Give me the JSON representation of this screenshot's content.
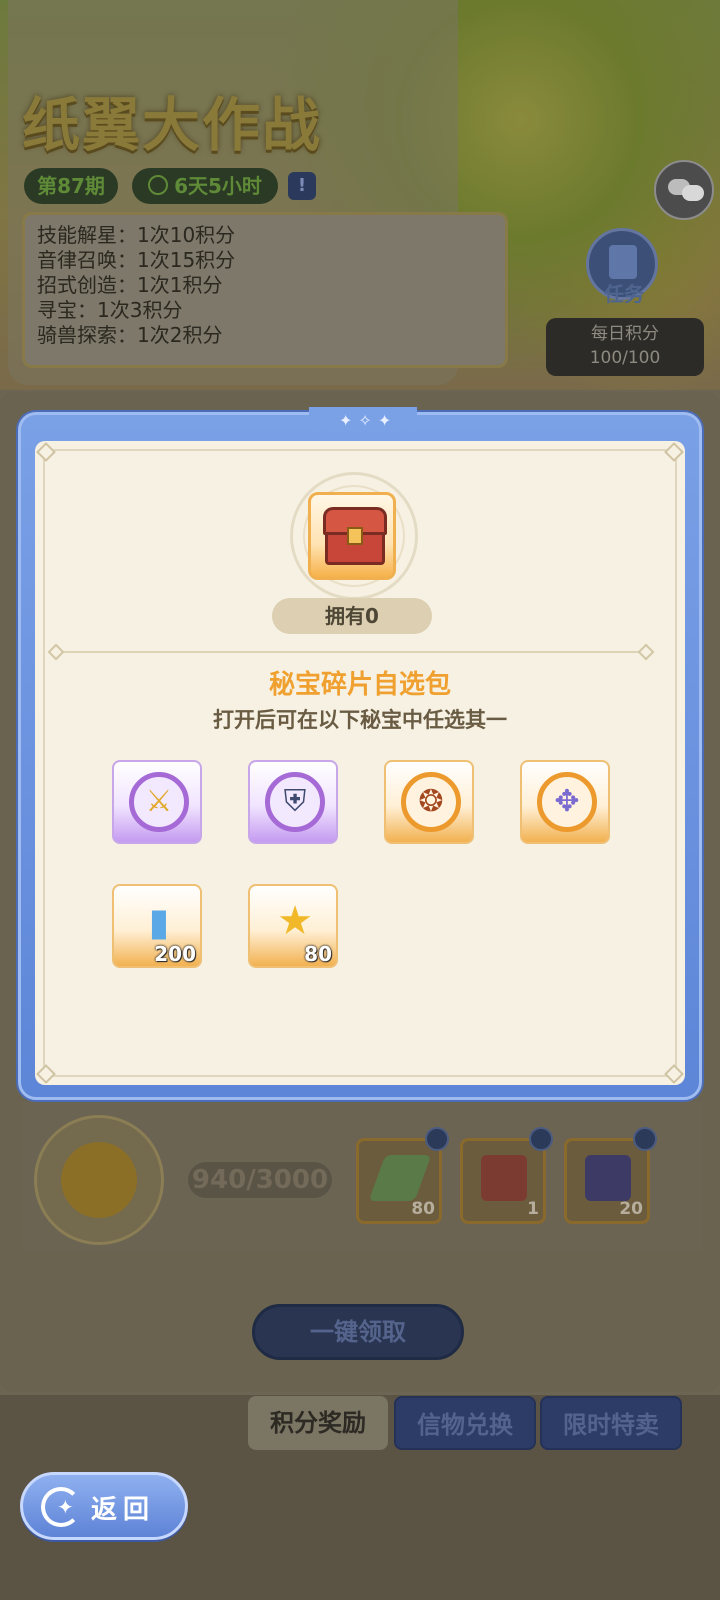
{
  "header": {
    "title": "纸翼大作战",
    "issue": "第87期",
    "countdown": "6天5小时",
    "info_icon": "!"
  },
  "rules": [
    "技能解星：1次10积分",
    "音律召唤：1次15积分",
    "招式创造：1次1积分",
    "寻宝：1次3积分",
    "骑兽探索：1次2积分"
  ],
  "side": {
    "task_label": "任务",
    "daily_label": "每日积分",
    "daily_value": "100/100"
  },
  "progress": {
    "text": "940/3000",
    "current": 940,
    "max": 3000
  },
  "rewards": [
    {
      "icon": "paper-plane-icon",
      "count": "80"
    },
    {
      "icon": "treasure-chest-icon",
      "count": "1"
    },
    {
      "icon": "crystal-icon",
      "count": "20"
    }
  ],
  "actions": {
    "claim_all": "一键领取"
  },
  "tabs": [
    {
      "label": "积分奖励",
      "active": true
    },
    {
      "label": "信物兑换",
      "active": false
    },
    {
      "label": "限时特卖",
      "active": false
    }
  ],
  "back": {
    "label": "返回"
  },
  "modal": {
    "owned": "拥有0",
    "pack_name": "秘宝碎片自选包",
    "pack_desc": "打开后可在以下秘宝中任选其一",
    "items": [
      {
        "icon": "trident-icon",
        "rarity": "purple",
        "qty": ""
      },
      {
        "icon": "shield-emblem-icon",
        "rarity": "purple",
        "qty": ""
      },
      {
        "icon": "ancient-scroll-icon",
        "rarity": "orange",
        "qty": ""
      },
      {
        "icon": "magic-staff-icon",
        "rarity": "orange",
        "qty": ""
      },
      {
        "icon": "crystal-canister-icon",
        "rarity": "orange",
        "qty": "200"
      },
      {
        "icon": "golden-star-icon",
        "rarity": "orange",
        "qty": "80"
      }
    ]
  },
  "colors": {
    "accent_orange": "#f0a02f",
    "modal_blue": "#7aa0e6",
    "panel_cream": "#f6f1e2"
  }
}
